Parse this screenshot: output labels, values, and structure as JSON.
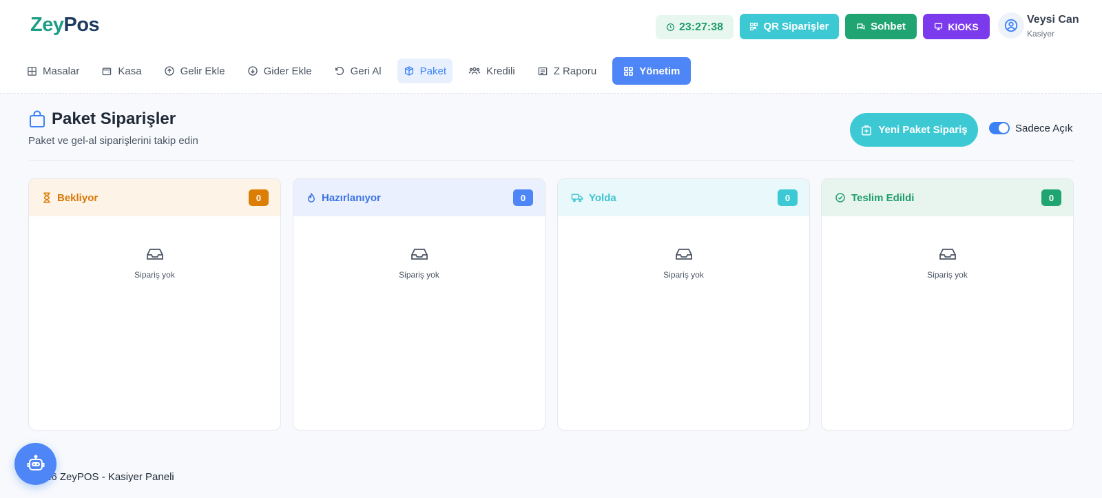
{
  "app": {
    "logo_part1": "Zey",
    "logo_part2": "Pos",
    "clock": "23:27:38",
    "qr_orders": "QR Siparişler",
    "chat": "Sohbet",
    "kiosk": "KIOKS",
    "user_name": "Veysi Can",
    "user_role": "Kasiyer"
  },
  "nav": {
    "items": [
      {
        "label": "Masalar",
        "icon": "grid-icon"
      },
      {
        "label": "Kasa",
        "icon": "wallet-icon"
      },
      {
        "label": "Gelir Ekle",
        "icon": "arrow-up-circle-icon"
      },
      {
        "label": "Gider Ekle",
        "icon": "arrow-down-circle-icon"
      },
      {
        "label": "Geri Al",
        "icon": "undo-icon"
      },
      {
        "label": "Paket",
        "icon": "box-icon"
      },
      {
        "label": "Kredili",
        "icon": "users-icon"
      },
      {
        "label": "Z Raporu",
        "icon": "receipt-icon"
      },
      {
        "label": "Yönetim",
        "icon": "dashboard-icon"
      }
    ],
    "active": "Paket"
  },
  "page": {
    "title": "Paket Siparişler",
    "subtitle": "Paket ve gel-al siparişlerini takip edin",
    "new_order_button": "Yeni Paket Sipariş",
    "toggle_label": "Sadece Açık",
    "toggle_on": true
  },
  "columns": [
    {
      "title": "Bekliyor",
      "count": "0",
      "icon": "hourglass-icon",
      "empty_text": "Sipariş yok",
      "color": "#dc7e06"
    },
    {
      "title": "Hazırlanıyor",
      "count": "0",
      "icon": "flame-icon",
      "empty_text": "Sipariş yok",
      "color": "#4f86f7"
    },
    {
      "title": "Yolda",
      "count": "0",
      "icon": "truck-icon",
      "empty_text": "Sipariş yok",
      "color": "#3cc9d4"
    },
    {
      "title": "Teslim Edildi",
      "count": "0",
      "icon": "check-circle-icon",
      "empty_text": "Sipariş yok",
      "color": "#1fa472"
    }
  ],
  "footer": {
    "text": "26 ZeyPOS - Kasiyer Paneli"
  },
  "assistant": {
    "icon": "robot-icon"
  }
}
